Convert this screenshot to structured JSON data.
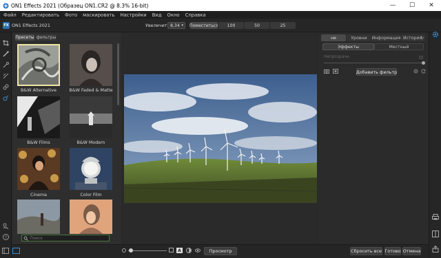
{
  "window": {
    "title": "ON1 Effects 2021 (Образец ON1.CR2 @ 8.3% 16-bit)",
    "minimize": "—",
    "maximize": "☐",
    "close": "✕"
  },
  "menu": [
    "Файл",
    "Редактировать",
    "Фото",
    "маскировать",
    "Настройки",
    "Вид",
    "Окно",
    "Справка"
  ],
  "app": {
    "name": "ON1 Effects 2021",
    "logo": "FX"
  },
  "toolbar": {
    "zoom_label": "Увеличить",
    "zoom_value": "8,34",
    "fit_label": "Поместиться",
    "zoom_presets": [
      "100",
      "50",
      "25"
    ]
  },
  "browser": {
    "tabs": [
      "Пресеты",
      "фильтры"
    ],
    "presets": [
      {
        "name": "B&W Alternative",
        "selected": true
      },
      {
        "name": "B&W Faded & Matte"
      },
      {
        "name": "B&W Films"
      },
      {
        "name": "B&W Modern"
      },
      {
        "name": "Cinema"
      },
      {
        "name": "Color Film"
      }
    ],
    "search_placeholder": "Поиск"
  },
  "right_panel": {
    "tabs": [
      "не",
      "Уровни",
      "Информация",
      "История"
    ],
    "subtabs": [
      "Эффекты",
      "Местный"
    ],
    "opacity_label": "Непрозрачн.",
    "add_filter": "Добавить фильтр"
  },
  "bottom": {
    "preview": "Просмотр",
    "reset_all": "Сбросить все",
    "done": "Готово",
    "cancel": "Отмена"
  },
  "colors": {
    "accent": "#3a8fd6",
    "selected_border": "#f2e6a6"
  }
}
